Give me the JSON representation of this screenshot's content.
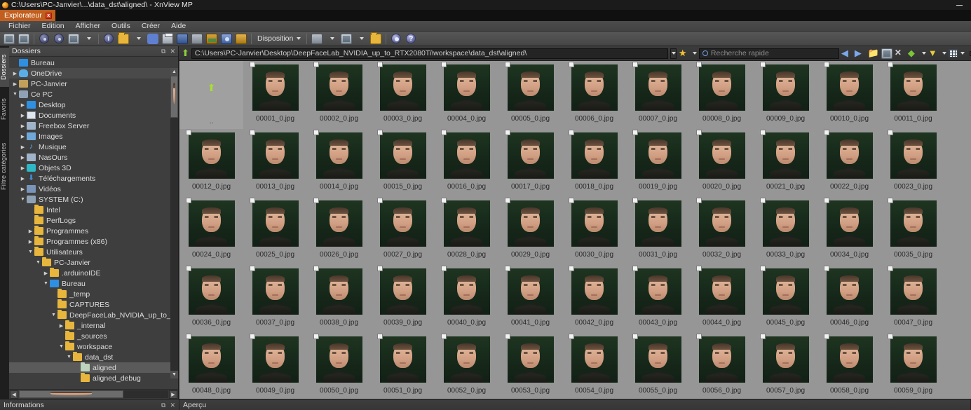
{
  "window": {
    "title": "C:\\Users\\PC-Janvier\\...\\data_dst\\aligned\\ - XnView MP",
    "app_icon": "xnview-icon",
    "minimize_label": "",
    "tab_label": "Explorateur",
    "tab_close_label": "x"
  },
  "menu": {
    "items": [
      {
        "label": "Fichier"
      },
      {
        "label": "Edition"
      },
      {
        "label": "Afficher"
      },
      {
        "label": "Outils"
      },
      {
        "label": "Créer"
      },
      {
        "label": "Aide"
      }
    ]
  },
  "toolbar": {
    "layout_label": "Disposition",
    "icons": [
      {
        "name": "browser-view-icon"
      },
      {
        "name": "fullscreen-view-icon"
      },
      {
        "name": "rotate-left-icon"
      },
      {
        "name": "rotate-right-icon"
      },
      {
        "name": "convert-batch-icon"
      },
      {
        "name": "image-info-icon"
      },
      {
        "name": "open-folder-icon"
      },
      {
        "name": "find-icon"
      },
      {
        "name": "print-icon"
      },
      {
        "name": "scan-icon"
      },
      {
        "name": "duplicate-icon"
      },
      {
        "name": "export-image-icon"
      },
      {
        "name": "screen-capture-icon"
      },
      {
        "name": "slideshow-icon"
      },
      {
        "name": "copy-to-icon"
      },
      {
        "name": "catalog-icon"
      },
      {
        "name": "new-folder-icon"
      },
      {
        "name": "settings-gear-icon"
      },
      {
        "name": "help-icon"
      }
    ]
  },
  "address": {
    "up_icon": "up-folder-icon",
    "path": "C:\\Users\\PC-Janvier\\Desktop\\DeepFaceLab_NVIDIA_up_to_RTX2080Ti\\workspace\\data_dst\\aligned\\",
    "favorites_icon": "star-icon",
    "search_placeholder": "Recherche rapide",
    "search_value": "",
    "nav_icons": [
      {
        "name": "back-arrow-icon"
      },
      {
        "name": "forward-arrow-icon"
      },
      {
        "name": "open-folder-icon"
      },
      {
        "name": "mount-icon"
      },
      {
        "name": "delete-icon"
      },
      {
        "name": "refresh-icon"
      },
      {
        "name": "filter-icon"
      },
      {
        "name": "view-mode-icon"
      }
    ],
    "zoom_slider": "thumbnail-size-slider"
  },
  "rail": {
    "tabs": [
      {
        "label": "Dossiers",
        "active": true
      },
      {
        "label": "Favoris",
        "active": false
      },
      {
        "label": "Filtre catégories",
        "active": false
      }
    ]
  },
  "folders_panel": {
    "header": "Dossiers",
    "undock_label": "⧉",
    "close_label": "✕",
    "tree": [
      {
        "label": "Bureau",
        "depth": 0,
        "expander": "",
        "icon": "desk",
        "state": ""
      },
      {
        "label": "OneDrive",
        "depth": 0,
        "expander": "▶",
        "icon": "cloud",
        "state": "highlight"
      },
      {
        "label": "PC-Janvier",
        "depth": 0,
        "expander": "▶",
        "icon": "pcj",
        "state": ""
      },
      {
        "label": "Ce PC",
        "depth": 0,
        "expander": "▼",
        "icon": "drive",
        "state": ""
      },
      {
        "label": "Desktop",
        "depth": 1,
        "expander": "▶",
        "icon": "desk",
        "state": ""
      },
      {
        "label": "Documents",
        "depth": 1,
        "expander": "▶",
        "icon": "doc",
        "state": ""
      },
      {
        "label": "Freebox Server",
        "depth": 1,
        "expander": "▶",
        "icon": "net",
        "state": ""
      },
      {
        "label": "Images",
        "depth": 1,
        "expander": "▶",
        "icon": "img",
        "state": ""
      },
      {
        "label": "Musique",
        "depth": 1,
        "expander": "▶",
        "icon": "music",
        "state": ""
      },
      {
        "label": "NasOurs",
        "depth": 1,
        "expander": "▶",
        "icon": "net",
        "state": ""
      },
      {
        "label": "Objets 3D",
        "depth": 1,
        "expander": "▶",
        "icon": "obj3d",
        "state": ""
      },
      {
        "label": "Téléchargements",
        "depth": 1,
        "expander": "▶",
        "icon": "dl",
        "state": ""
      },
      {
        "label": "Vidéos",
        "depth": 1,
        "expander": "▶",
        "icon": "vid",
        "state": ""
      },
      {
        "label": "SYSTEM (C:)",
        "depth": 1,
        "expander": "▼",
        "icon": "drive",
        "state": ""
      },
      {
        "label": "Intel",
        "depth": 2,
        "expander": "",
        "icon": "fld",
        "state": ""
      },
      {
        "label": "PerfLogs",
        "depth": 2,
        "expander": "",
        "icon": "fld",
        "state": ""
      },
      {
        "label": "Programmes",
        "depth": 2,
        "expander": "▶",
        "icon": "fld",
        "state": ""
      },
      {
        "label": "Programmes (x86)",
        "depth": 2,
        "expander": "▶",
        "icon": "fld",
        "state": ""
      },
      {
        "label": "Utilisateurs",
        "depth": 2,
        "expander": "▼",
        "icon": "fld",
        "state": ""
      },
      {
        "label": "PC-Janvier",
        "depth": 3,
        "expander": "▼",
        "icon": "fld",
        "state": ""
      },
      {
        "label": ".arduinoIDE",
        "depth": 4,
        "expander": "▶",
        "icon": "fld",
        "state": ""
      },
      {
        "label": "Bureau",
        "depth": 4,
        "expander": "▼",
        "icon": "desk",
        "state": ""
      },
      {
        "label": "_temp",
        "depth": 5,
        "expander": "",
        "icon": "fld",
        "state": ""
      },
      {
        "label": "CAPTURES",
        "depth": 5,
        "expander": "",
        "icon": "fld",
        "state": ""
      },
      {
        "label": "DeepFaceLab_NVIDIA_up_to_R",
        "depth": 5,
        "expander": "▼",
        "icon": "fld",
        "state": ""
      },
      {
        "label": "_internal",
        "depth": 6,
        "expander": "▶",
        "icon": "fld",
        "state": ""
      },
      {
        "label": "_sources",
        "depth": 6,
        "expander": "",
        "icon": "fld",
        "state": ""
      },
      {
        "label": "workspace",
        "depth": 6,
        "expander": "▼",
        "icon": "fld",
        "state": ""
      },
      {
        "label": "data_dst",
        "depth": 7,
        "expander": "▼",
        "icon": "fld",
        "state": ""
      },
      {
        "label": "aligned",
        "depth": 8,
        "expander": "",
        "icon": "fldpale",
        "state": "sel"
      },
      {
        "label": "aligned_debug",
        "depth": 8,
        "expander": "",
        "icon": "fld",
        "state": ""
      }
    ]
  },
  "browser": {
    "updir_label": "..",
    "updir_icon": "up-arrow-icon",
    "files": [
      {
        "name": "00001_0.jpg"
      },
      {
        "name": "00002_0.jpg"
      },
      {
        "name": "00003_0.jpg"
      },
      {
        "name": "00004_0.jpg"
      },
      {
        "name": "00005_0.jpg"
      },
      {
        "name": "00006_0.jpg"
      },
      {
        "name": "00007_0.jpg"
      },
      {
        "name": "00008_0.jpg"
      },
      {
        "name": "00009_0.jpg"
      },
      {
        "name": "00010_0.jpg"
      },
      {
        "name": "00011_0.jpg"
      },
      {
        "name": "00012_0.jpg"
      },
      {
        "name": "00013_0.jpg"
      },
      {
        "name": "00014_0.jpg"
      },
      {
        "name": "00015_0.jpg"
      },
      {
        "name": "00016_0.jpg"
      },
      {
        "name": "00017_0.jpg"
      },
      {
        "name": "00018_0.jpg"
      },
      {
        "name": "00019_0.jpg"
      },
      {
        "name": "00020_0.jpg"
      },
      {
        "name": "00021_0.jpg"
      },
      {
        "name": "00022_0.jpg"
      },
      {
        "name": "00023_0.jpg"
      },
      {
        "name": "00024_0.jpg"
      },
      {
        "name": "00025_0.jpg"
      },
      {
        "name": "00026_0.jpg"
      },
      {
        "name": "00027_0.jpg"
      },
      {
        "name": "00028_0.jpg"
      },
      {
        "name": "00029_0.jpg"
      },
      {
        "name": "00030_0.jpg"
      },
      {
        "name": "00031_0.jpg"
      },
      {
        "name": "00032_0.jpg"
      },
      {
        "name": "00033_0.jpg"
      },
      {
        "name": "00034_0.jpg"
      },
      {
        "name": "00035_0.jpg"
      },
      {
        "name": "00036_0.jpg"
      },
      {
        "name": "00037_0.jpg"
      },
      {
        "name": "00038_0.jpg"
      },
      {
        "name": "00039_0.jpg"
      },
      {
        "name": "00040_0.jpg"
      },
      {
        "name": "00041_0.jpg"
      },
      {
        "name": "00042_0.jpg"
      },
      {
        "name": "00043_0.jpg"
      },
      {
        "name": "00044_0.jpg"
      },
      {
        "name": "00045_0.jpg"
      },
      {
        "name": "00046_0.jpg"
      },
      {
        "name": "00047_0.jpg"
      },
      {
        "name": "00048_0.jpg"
      },
      {
        "name": "00049_0.jpg"
      },
      {
        "name": "00050_0.jpg"
      },
      {
        "name": "00051_0.jpg"
      },
      {
        "name": "00052_0.jpg"
      },
      {
        "name": "00053_0.jpg"
      },
      {
        "name": "00054_0.jpg"
      },
      {
        "name": "00055_0.jpg"
      },
      {
        "name": "00056_0.jpg"
      },
      {
        "name": "00057_0.jpg"
      },
      {
        "name": "00058_0.jpg"
      },
      {
        "name": "00059_0.jpg"
      }
    ]
  },
  "status": {
    "info_panel": "Informations",
    "preview_panel": "Aperçu",
    "undock_label": "⧉",
    "close_label": "✕"
  },
  "colors": {
    "accent_orange": "#c25f1e",
    "panel_bg": "#3e3e3e",
    "browser_bg": "#969696",
    "thumb_green": "#1e3520",
    "selection": "#5a5a5a"
  }
}
